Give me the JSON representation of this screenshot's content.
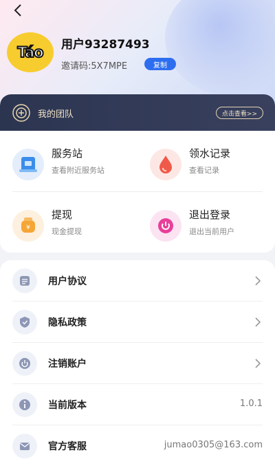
{
  "header": {
    "back_icon": "chevron-left-icon",
    "avatar_text": "Táo",
    "avatar_color": "#f7cc2f",
    "username": "用户93287493",
    "invite_code": "邀请码:5X7MPE",
    "copy_label": "复制"
  },
  "team": {
    "title": "我的团队",
    "view_label": "点击查看>>",
    "icon": "plus-badge-icon"
  },
  "services": [
    {
      "title": "服务站",
      "subtitle": "查看附近服务站",
      "icon": "station-icon"
    },
    {
      "title": "领水记录",
      "subtitle": "查看记录",
      "icon": "water-drop-icon"
    },
    {
      "title": "提现",
      "subtitle": "现金提现",
      "icon": "money-bag-icon"
    },
    {
      "title": "退出登录",
      "subtitle": "退出当前用户",
      "icon": "power-icon"
    }
  ],
  "menu": [
    {
      "label": "用户协议",
      "icon": "document-icon",
      "value": ""
    },
    {
      "label": "隐私政策",
      "icon": "shield-icon",
      "value": ""
    },
    {
      "label": "注销账户",
      "icon": "power-icon",
      "value": ""
    },
    {
      "label": "当前版本",
      "icon": "info-icon",
      "value": "1.0.1"
    },
    {
      "label": "官方客服",
      "icon": "mail-icon",
      "value": "jumao0305@163.com"
    }
  ],
  "colors": {
    "accent": "#2d6ef0",
    "team_bar": "#2c3550",
    "team_text": "#f1e3c8"
  }
}
